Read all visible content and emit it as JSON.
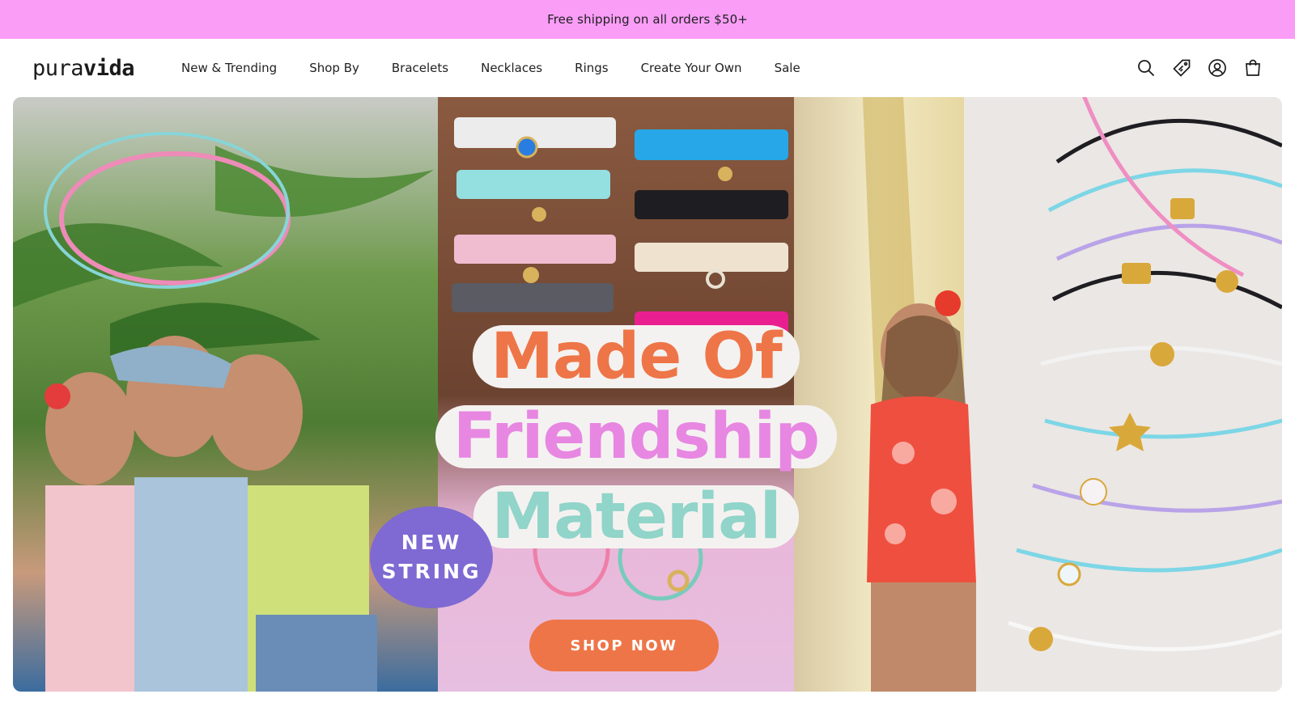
{
  "announcement": {
    "text": "Free shipping on all orders $50+"
  },
  "header": {
    "logo_light": "pura",
    "logo_bold": "vida",
    "nav": [
      {
        "label": "New & Trending"
      },
      {
        "label": "Shop By"
      },
      {
        "label": "Bracelets"
      },
      {
        "label": "Necklaces"
      },
      {
        "label": "Rings"
      },
      {
        "label": "Create Your Own"
      },
      {
        "label": "Sale"
      }
    ],
    "icons": [
      "search-icon",
      "tag-icon",
      "account-icon",
      "cart-icon"
    ]
  },
  "hero": {
    "headline": {
      "line1": "Made Of",
      "line2": "Friendship",
      "line3": "Material"
    },
    "badge": {
      "line1": "NEW",
      "line2": "STRING"
    },
    "cta": "SHOP NOW"
  },
  "colors": {
    "announcement_bg": "#f99df7",
    "accent_orange": "#ee7548",
    "accent_pink": "#e787e2",
    "accent_mint": "#91d4c9",
    "badge_purple": "#7e6ad2"
  }
}
